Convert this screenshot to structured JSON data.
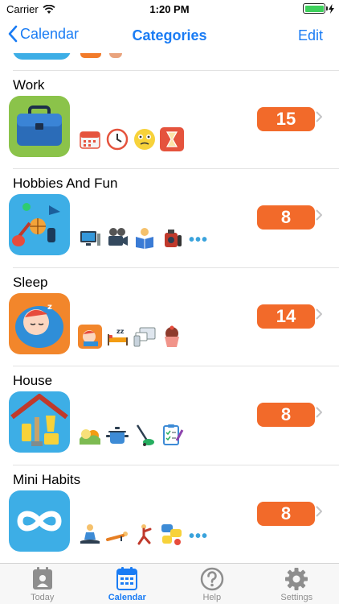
{
  "status_bar": {
    "carrier": "Carrier",
    "time": "1:20 PM",
    "battery_level": 1.0
  },
  "nav": {
    "back_label": "Calendar",
    "title": "Categories",
    "edit_label": "Edit"
  },
  "categories": [
    {
      "name": "Work",
      "count": "15",
      "icons": [
        "calendar-icon",
        "clock-icon",
        "confused-face-icon",
        "hourglass-icon"
      ]
    },
    {
      "name": "Hobbies And Fun",
      "count": "8",
      "icons": [
        "computer-icon",
        "film-camera-icon",
        "reading-icon",
        "camera-bag-icon",
        "more-icon"
      ]
    },
    {
      "name": "Sleep",
      "count": "14",
      "icons": [
        "sleeping-face-icon",
        "bed-icon",
        "devices-icon",
        "cupcake-icon"
      ]
    },
    {
      "name": "House",
      "count": "8",
      "icons": [
        "sunrise-icon",
        "cooking-pot-icon",
        "vacuum-icon",
        "checklist-icon"
      ]
    },
    {
      "name": "Mini Habits",
      "count": "8",
      "icons": [
        "meditation-icon",
        "plank-icon",
        "stretch-icon",
        "chat-icon",
        "more-icon"
      ]
    }
  ],
  "tabs": [
    {
      "label": "Today",
      "icon": "today-icon",
      "active": false
    },
    {
      "label": "Calendar",
      "icon": "calendar-tab-icon",
      "active": true
    },
    {
      "label": "Help",
      "icon": "help-icon",
      "active": false
    },
    {
      "label": "Settings",
      "icon": "settings-icon",
      "active": false
    }
  ],
  "colors": {
    "accent": "#1a7cf4",
    "badge": "#f26a2a",
    "tab_inactive": "#8e8e8e"
  }
}
